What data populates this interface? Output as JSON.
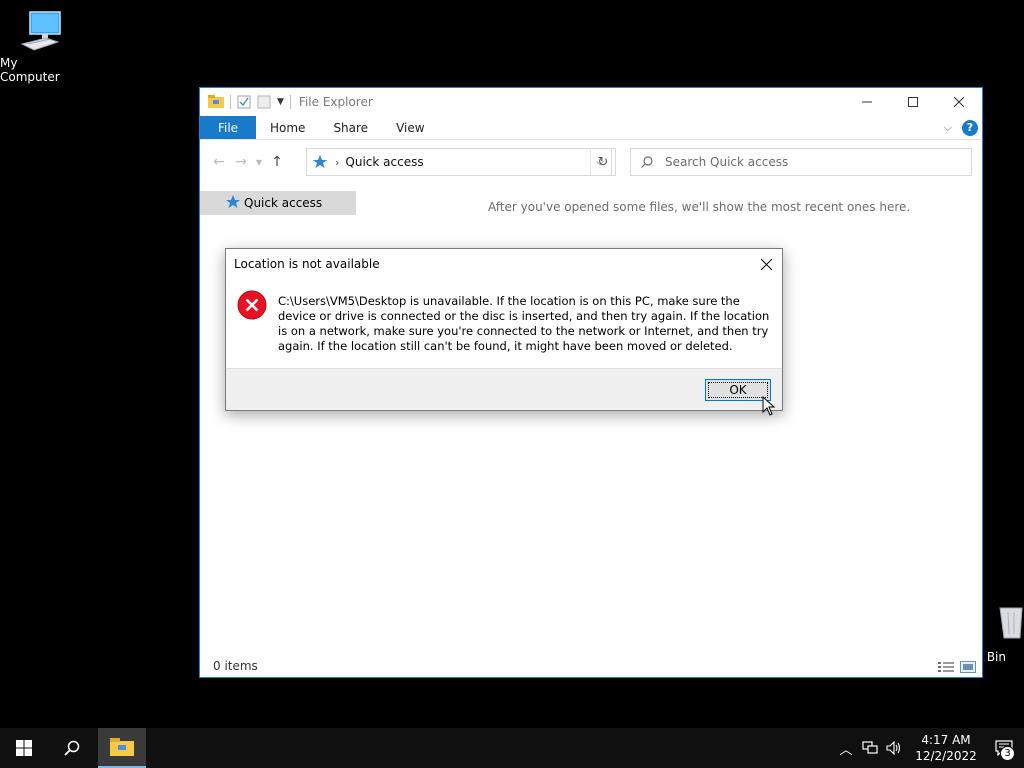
{
  "desktop": {
    "icons": [
      {
        "label": "My Computer"
      },
      {
        "label": "e Bin"
      }
    ]
  },
  "explorer": {
    "title": "File Explorer",
    "ribbon": {
      "tabs": [
        {
          "label": "File"
        },
        {
          "label": "Home"
        },
        {
          "label": "Share"
        },
        {
          "label": "View"
        }
      ],
      "help": "?"
    },
    "address": {
      "crumb": "Quick access"
    },
    "search": {
      "placeholder": "Search Quick access"
    },
    "sidebar": {
      "items": [
        {
          "label": "Quick access"
        }
      ]
    },
    "empty_message": "After you've opened some files, we'll show the most recent ones here.",
    "status": "0 items"
  },
  "dialog": {
    "title": "Location is not available",
    "message": "C:\\Users\\VM5\\Desktop is unavailable. If the location is on this PC, make sure the device or drive is connected or the disc is inserted, and then try again. If the location is on a network, make sure you're connected to the network or Internet, and then try again. If the location still can't be found, it might have been moved or deleted.",
    "ok_label": "OK"
  },
  "taskbar": {
    "clock": {
      "time": "4:17 AM",
      "date": "12/2/2022"
    },
    "notification_count": "3"
  },
  "colors": {
    "accent": "#1979ca",
    "window_border": "#1883d7",
    "error_red": "#e81123",
    "folder_yellow": "#f7c948"
  }
}
